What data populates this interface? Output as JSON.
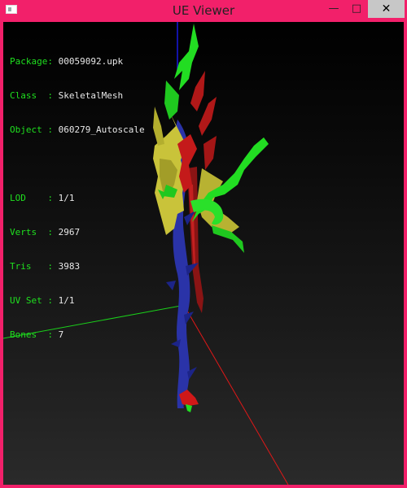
{
  "window": {
    "title": "UE Viewer",
    "minimize_glyph": "—",
    "maximize_glyph": "□",
    "close_glyph": "✕"
  },
  "info": {
    "package_key": "Package: ",
    "package": "00059092.upk",
    "class_key": "Class  : ",
    "class": "SkeletalMesh",
    "object_key": "Object : ",
    "object": "060279_Autoscale",
    "lod_key": "LOD    : ",
    "lod": "1/1",
    "verts_key": "Verts  : ",
    "verts": "2967",
    "tris_key": "Tris   : ",
    "tris": "3983",
    "uvset_key": "UV Set : ",
    "uvset": "1/1",
    "bones_key": "Bones  : ",
    "bones": "7"
  },
  "colors": {
    "frame": "#f2206a",
    "label": "#1fe01f",
    "value": "#e8e8e8",
    "mesh_yellow": "#c9c33a",
    "mesh_blue": "#2a33a8",
    "mesh_red": "#b01818",
    "mesh_green": "#22dd22"
  }
}
